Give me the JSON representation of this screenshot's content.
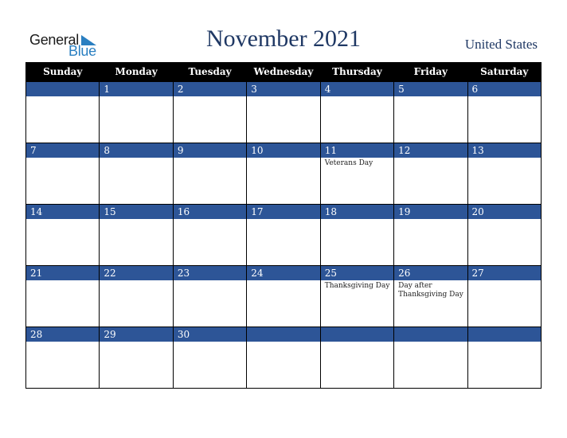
{
  "brand": {
    "line1": "General",
    "line2": "Blue",
    "accent": "#2a7fc1"
  },
  "header": {
    "title": "November 2021",
    "country": "United States"
  },
  "colors": {
    "title": "#1f3864",
    "daybar": "#2d5597",
    "weekday_header": "#000000"
  },
  "weekdays": [
    "Sunday",
    "Monday",
    "Tuesday",
    "Wednesday",
    "Thursday",
    "Friday",
    "Saturday"
  ],
  "weeks": [
    [
      {
        "day": "",
        "event": ""
      },
      {
        "day": "1",
        "event": ""
      },
      {
        "day": "2",
        "event": ""
      },
      {
        "day": "3",
        "event": ""
      },
      {
        "day": "4",
        "event": ""
      },
      {
        "day": "5",
        "event": ""
      },
      {
        "day": "6",
        "event": ""
      }
    ],
    [
      {
        "day": "7",
        "event": ""
      },
      {
        "day": "8",
        "event": ""
      },
      {
        "day": "9",
        "event": ""
      },
      {
        "day": "10",
        "event": ""
      },
      {
        "day": "11",
        "event": "Veterans Day"
      },
      {
        "day": "12",
        "event": ""
      },
      {
        "day": "13",
        "event": ""
      }
    ],
    [
      {
        "day": "14",
        "event": ""
      },
      {
        "day": "15",
        "event": ""
      },
      {
        "day": "16",
        "event": ""
      },
      {
        "day": "17",
        "event": ""
      },
      {
        "day": "18",
        "event": ""
      },
      {
        "day": "19",
        "event": ""
      },
      {
        "day": "20",
        "event": ""
      }
    ],
    [
      {
        "day": "21",
        "event": ""
      },
      {
        "day": "22",
        "event": ""
      },
      {
        "day": "23",
        "event": ""
      },
      {
        "day": "24",
        "event": ""
      },
      {
        "day": "25",
        "event": "Thanksgiving Day"
      },
      {
        "day": "26",
        "event": "Day after Thanksgiving Day"
      },
      {
        "day": "27",
        "event": ""
      }
    ],
    [
      {
        "day": "28",
        "event": ""
      },
      {
        "day": "29",
        "event": ""
      },
      {
        "day": "30",
        "event": ""
      },
      {
        "day": "",
        "event": ""
      },
      {
        "day": "",
        "event": ""
      },
      {
        "day": "",
        "event": ""
      },
      {
        "day": "",
        "event": ""
      }
    ]
  ]
}
